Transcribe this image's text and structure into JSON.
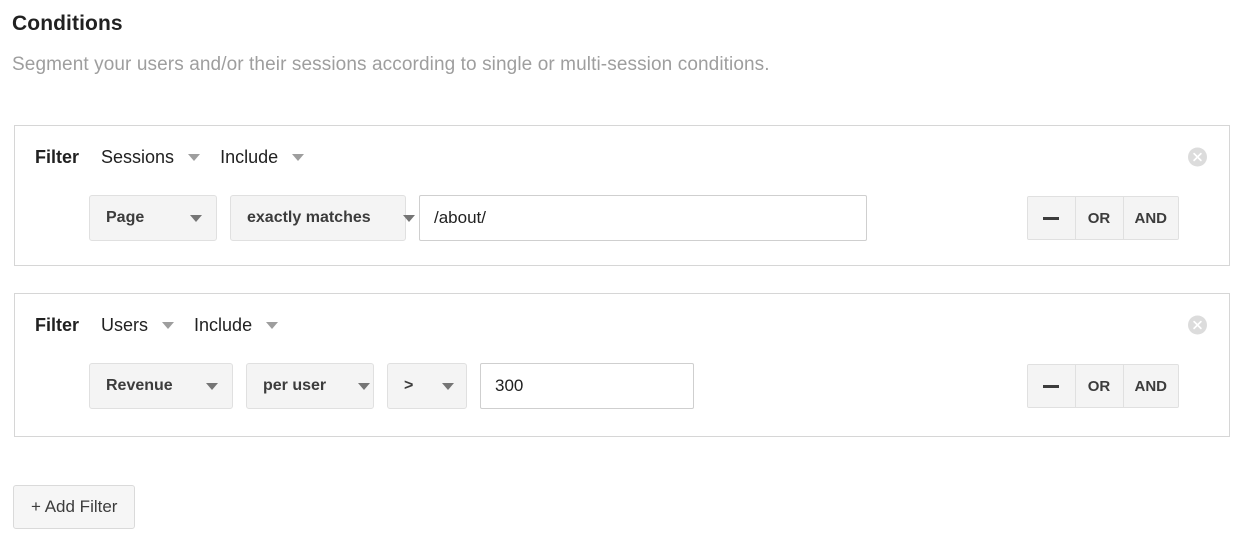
{
  "header": {
    "title": "Conditions",
    "subtitle": "Segment your users and/or their sessions according to single or multi-session conditions."
  },
  "filters": [
    {
      "filter_label": "Filter",
      "scope": "Sessions",
      "mode": "Include",
      "close_icon": "close-circle-icon",
      "condition": {
        "dimension": "Page",
        "operator": "exactly matches",
        "value": "/about/",
        "value_placeholder": ""
      },
      "logic": {
        "remove_label": "−",
        "or_label": "OR",
        "and_label": "AND"
      }
    },
    {
      "filter_label": "Filter",
      "scope": "Users",
      "mode": "Include",
      "close_icon": "close-circle-icon",
      "condition": {
        "dimension": "Revenue",
        "aggregation": "per user",
        "operator": ">",
        "value": "300",
        "value_placeholder": ""
      },
      "logic": {
        "remove_label": "−",
        "or_label": "OR",
        "and_label": "AND"
      }
    }
  ],
  "add_filter": {
    "label": "+ Add Filter"
  },
  "colors": {
    "title_text": "#212121",
    "subtitle_text": "#9e9e9e",
    "card_border": "#d6d6d6",
    "chip_bg": "#f4f4f4",
    "chip_border": "#e0e0e0",
    "input_border": "#cfcfcf",
    "close_icon_bg": "#dcdcdc",
    "caret": "#9e9e9e"
  }
}
